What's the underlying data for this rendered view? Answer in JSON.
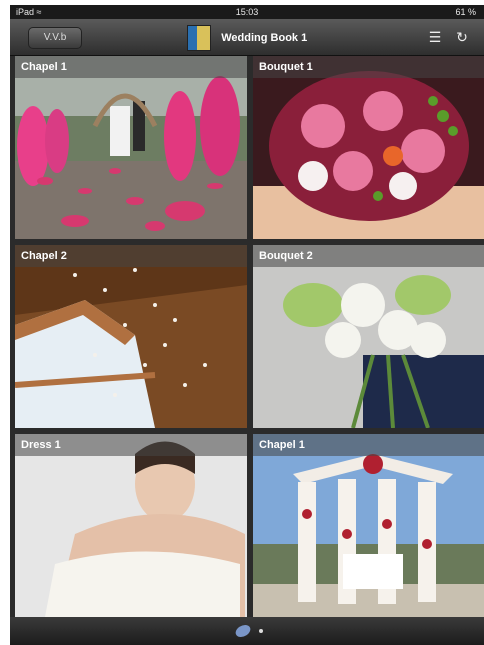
{
  "status_bar": {
    "carrier": "iPad ≈",
    "time": "15:03",
    "battery": "61 %"
  },
  "nav": {
    "back_label": "V.V.b",
    "title": "Wedding Book 1",
    "icons": [
      "book-icon",
      "share-icon",
      "refresh-icon"
    ]
  },
  "tiles": [
    {
      "label": "Chapel 1"
    },
    {
      "label": "Bouquet 1"
    },
    {
      "label": "Chapel 2"
    },
    {
      "label": "Bouquet 2"
    },
    {
      "label": "Dress 1"
    },
    {
      "label": "Chapel 1"
    }
  ],
  "bottom": {
    "icons": [
      "page-thumbnail-icon",
      "page-indicator-dot"
    ]
  }
}
